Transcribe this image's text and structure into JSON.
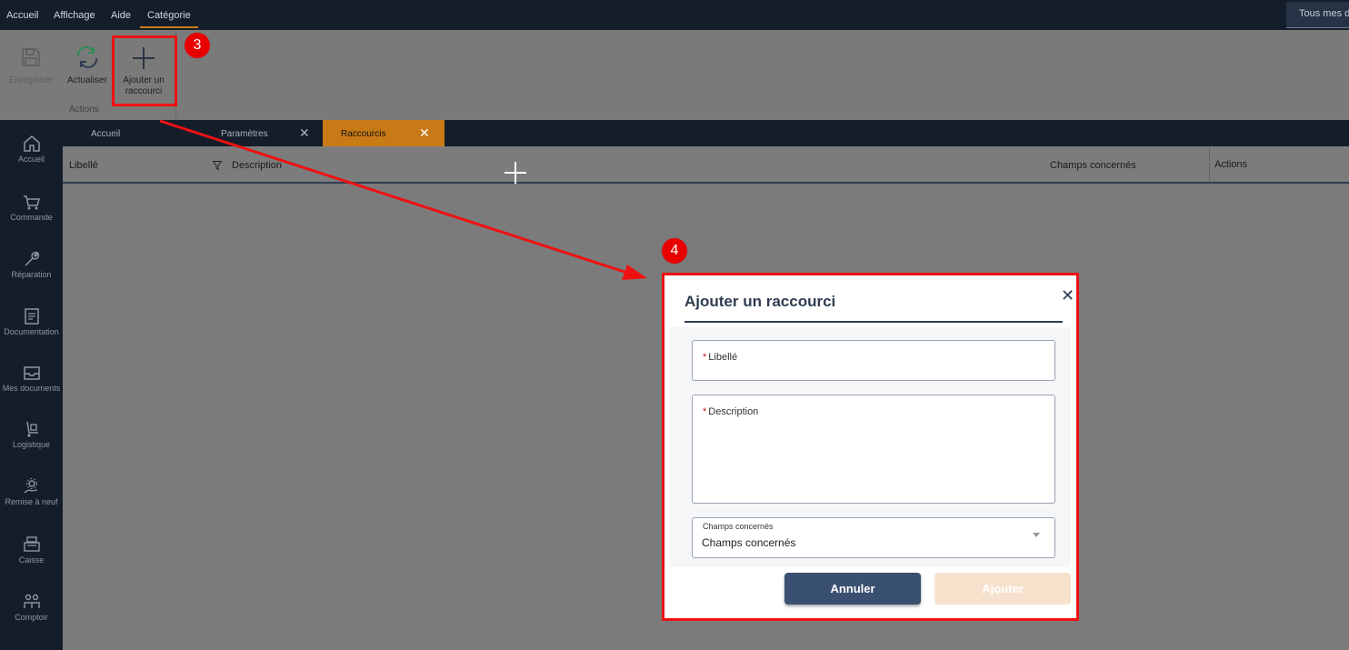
{
  "menu": {
    "items": [
      "Accueil",
      "Affichage",
      "Aide",
      "Catégorie"
    ],
    "search_placeholder": "Tous mes do"
  },
  "ribbon": {
    "save_label": "Enregistrer",
    "refresh_label": "Actualiser",
    "add_label_line1": "Ajouter un",
    "add_label_line2": "raccourci",
    "group_label": "Actions",
    "badge_step3": "3"
  },
  "nav": {
    "items": [
      "Accueil",
      "Commande",
      "Réparation",
      "Documentation",
      "Mes documents",
      "Logistique",
      "Remise à neuf",
      "Caisse",
      "Comptoir"
    ]
  },
  "tabs": [
    {
      "label": "Accueil"
    },
    {
      "label": "Paramètres"
    },
    {
      "label": "Raccourcis"
    }
  ],
  "grid": {
    "columns": [
      "Libellé",
      "Description",
      "Champs concernés",
      "Actions"
    ]
  },
  "dialog": {
    "badge_step4": "4",
    "title": "Ajouter un raccourci",
    "label_field": "Libellé",
    "description_field": "Description",
    "select_label": "Champs concernés",
    "select_value": "Champs concernés",
    "cancel_label": "Annuler",
    "add_label": "Ajouter",
    "required_mark": "*"
  },
  "colors": {
    "accent": "#c87a17",
    "dark": "#141d2a",
    "highlight": "#ee1111",
    "primary_button": "#3a5070"
  }
}
